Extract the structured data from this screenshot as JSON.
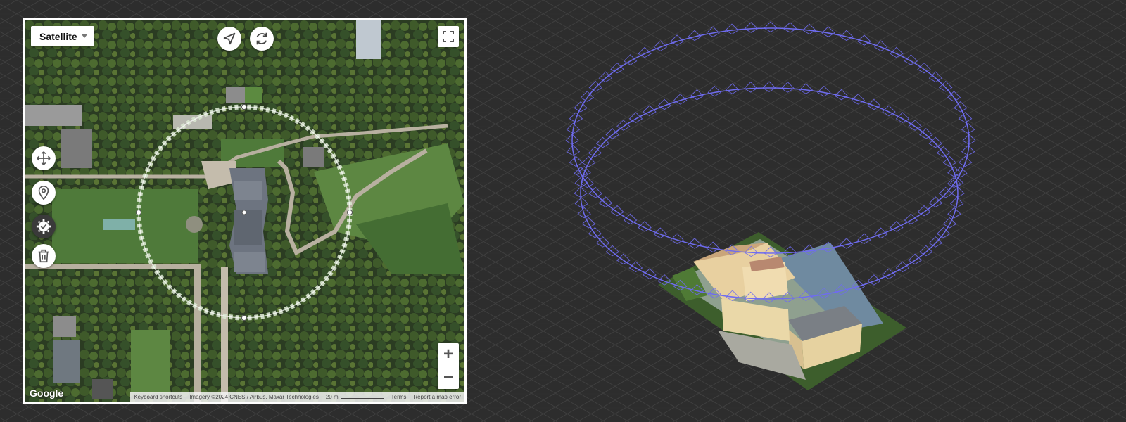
{
  "map": {
    "type_label": "Satellite",
    "zoom_in_label": "+",
    "zoom_out_label": "−",
    "logo": "Google",
    "attribution": {
      "shortcuts": "Keyboard shortcuts",
      "imagery": "Imagery ©2024 CNES / Airbus, Maxar Technologies",
      "scale": "20 m",
      "terms": "Terms",
      "report": "Report a map error"
    },
    "toolbar_icons": [
      "navigation-arrow-icon",
      "refresh-icon"
    ],
    "side_tools": [
      "move-icon",
      "location-pin-icon",
      "settings-check-icon",
      "trash-icon"
    ]
  },
  "flight_path": {
    "orbit_color": "#6f6cf0",
    "orbits": 2
  },
  "colors": {
    "background": "#2d2d2d",
    "grid": "#3f3f3f",
    "circle_path": "#d9e6d0"
  }
}
